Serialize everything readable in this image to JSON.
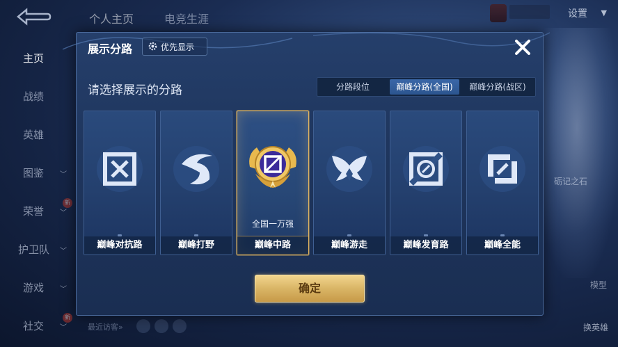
{
  "background": {
    "top_nav": [
      "个人主页",
      "电竞生涯"
    ],
    "settings_label": "设置",
    "sidebar": [
      {
        "label": "主页",
        "has_caret": false,
        "active": true
      },
      {
        "label": "战绩",
        "has_caret": false
      },
      {
        "label": "英雄",
        "has_caret": false
      },
      {
        "label": "图鉴",
        "has_caret": true
      },
      {
        "label": "荣誉",
        "has_caret": true,
        "badge": "新"
      },
      {
        "label": "护卫队",
        "has_caret": true
      },
      {
        "label": "游戏",
        "has_caret": true
      },
      {
        "label": "社交",
        "has_caret": true,
        "badge": "新"
      }
    ],
    "recent_visitors": "最近访客»",
    "right_labels": {
      "stone": "砺记之石",
      "model": "模型",
      "swap": "换英雄"
    }
  },
  "modal": {
    "title": "展示分路",
    "priority_button": "优先显示",
    "subtitle": "请选择展示的分路",
    "tabs": [
      {
        "label": "分路段位",
        "active": false
      },
      {
        "label": "巅峰分路(全国)",
        "active": true
      },
      {
        "label": "巅峰分路(战区)",
        "active": false
      }
    ],
    "cards": [
      {
        "label": "巅峰对抗路",
        "icon": "clash-lane-icon",
        "selected": false
      },
      {
        "label": "巅峰打野",
        "icon": "jungle-icon",
        "selected": false
      },
      {
        "label": "巅峰中路",
        "icon": "mid-lane-icon",
        "selected": true,
        "rank": "全国一万强"
      },
      {
        "label": "巅峰游走",
        "icon": "roam-icon",
        "selected": false
      },
      {
        "label": "巅峰发育路",
        "icon": "farm-lane-icon",
        "selected": false
      },
      {
        "label": "巅峰全能",
        "icon": "all-round-icon",
        "selected": false
      }
    ],
    "confirm_label": "确定"
  },
  "colors": {
    "accent_gold": "#e7b860",
    "panel": "#1f365e",
    "tab_active": "#2c558f"
  }
}
